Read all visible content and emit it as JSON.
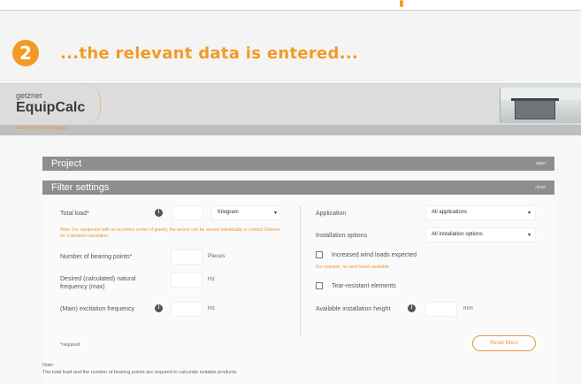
{
  "step": {
    "number": "2",
    "text": "...the relevant data is entered..."
  },
  "header": {
    "brand_small": "getzner",
    "app_name": "EquipCalc",
    "sub_link": "Back to Product Catalogue"
  },
  "panels": {
    "project": {
      "title": "Project",
      "action": "open"
    },
    "filter": {
      "title": "Filter settings",
      "action": "close"
    }
  },
  "left": {
    "total_load": {
      "label": "Total load*",
      "unit_select": "Kilogram",
      "note": "Note: For equipment with an eccentric center of gravity, the sensor can be viewed individually or contact Getzner for a detailed calculation."
    },
    "bearing_points": {
      "label": "Number of bearing points*",
      "unit": "Pieces"
    },
    "natural_frequency": {
      "label": "Desired (calculated) natural frequency (max)",
      "unit": "Hz"
    },
    "excitation": {
      "label": "(Main) excitation frequency",
      "unit": "Hz"
    },
    "required": "*required"
  },
  "right": {
    "application": {
      "label": "Application",
      "value": "All applications"
    },
    "installation": {
      "label": "Installation options",
      "value": "All installation options"
    },
    "wind": {
      "label": "Increased wind loads expected",
      "note": "For example, no wind break available"
    },
    "tear": {
      "label": "Tear-resistant elements"
    },
    "height": {
      "label": "Available installation height",
      "unit": "mm"
    },
    "reset": "Reset filters"
  },
  "footer": {
    "note_title": "Note:",
    "note_text": "The total load and the number of bearing points are required to calculate suitable products."
  },
  "colors": {
    "accent": "#f39a25",
    "panel": "#8e8e8e"
  }
}
